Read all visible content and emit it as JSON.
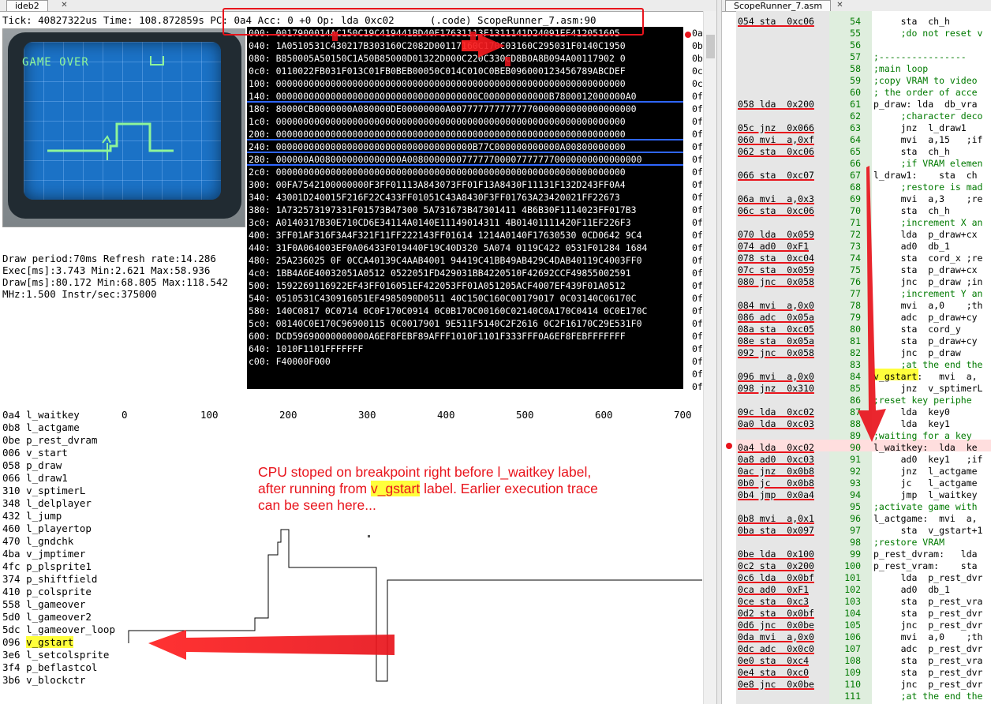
{
  "left_window": {
    "tab_label": "ideb2",
    "close_glyph": "✕",
    "status_line": "Tick: 40827322us Time: 108.872859s PC: 0a4 Acc: 0 +0 Op: lda 0xc02      (.code) ScopeRunner_7.asm:90",
    "scope_photo": {
      "screen_text": "GAME OVER"
    },
    "stats": [
      "Draw period:70ms Refresh rate:14.286",
      "Exec[ms]:3.743 Min:2.621 Max:58.936",
      "Draw[ms]:80.172 Min:68.805 Max:118.542",
      "MHz:1.500 Instr/sec:375000"
    ],
    "memory_rows": [
      "000: 0017900014AC150C19C419441BD40F17631113F1311141D24091EF412051605",
      "040: 1A0510531C430217B303160C2082D00117160C170C03160C295031F0140C1950",
      "080: B850005A50150C1A50B85000D01322D000C220C330CD8B0A8B094A00117902 0",
      "0c0: 0110022FB031F013C01FB0BEB00050C014C010C0BEB096000123456789ABCDEF",
      "100: 0000000000000000000000000000000000000000000000000000000000000000",
      "140: 0000000000000000000000000000000000000C000000000000B7800012000000A0",
      "180: 80000CB0000000A080000DE00000000A0077777777777770000000000000000000",
      "1c0: 0000000000000000000000000000000000000000000000000000000000000000",
      "200: 0000000000000000000000000000000000000000000000000000000000000000",
      "240: 000000000000000000000000000000000000B77C000000000000A00800000000",
      "280: 000000A0080000000000000A0080000000777777000077777770000000000000000",
      "2c0: 0000000000000000000000000000000000000000000000000000000000000000",
      "300: 00FA7542100000000F3FF01113A843073FF01F13A8430F11131F132D243FF0A4",
      "340: 43001D240015F216F22C433FF01051C43A8430F3FF01763A23420021FF22673",
      "380: 1A732573197331F01573B47300 5A731673B47301411 4B6B30F1114023FF017B3",
      "3c0: A0140317B30E710CD6E34114A0140E11149014311 4B01401111420F11EF226F3",
      "400: 3FF01AF316F3A4F321F11FF222143FF01614 1214A0140F17630530 0CD0642 9C4",
      "440: 31F0A064003EF0A06433F019440F19C40D320 5A074 0119C422 0531F01284 1684",
      "480: 25A236025 0F 0CCA40139C4AAB4001 94419C41BB49AB429C4DAB40119C4003FF0",
      "4c0: 1BB4A6E40032051A0512 0522051FD429031BB4220510F42692CCF49855002591",
      "500: 1592269116922EF43FF016051EF422053FF01A051205ACF4007EF439F01A0512",
      "540: 0510531C430916051EF4985090D0511 40C150C160C00179017 0C03140C06170C",
      "580: 140C0817 0C0714 0C0F170C0914 0C0B170C00160C02140C0A170C0414 0C0E170C",
      "5c0: 08140C0E170C96900115 0C0017901 9E511F5140C2F2616 0C2F16170C29E531F0",
      "600: DCD59690000000000A6EF8FEBF89AFFF1010F1101F333FFF0A6EF8FEBFFFFFFF",
      "640: 1010F1101FFFFFFF",
      "c00: F40000F000"
    ],
    "right_column_values": [
      "0a",
      "0b",
      "0b",
      "0c",
      "0c",
      "0f",
      "0f",
      "0f",
      "0f",
      "0f",
      "0f",
      "0f",
      "0f",
      "0f",
      "0f",
      "0f",
      "0f",
      "0f",
      "0f",
      "0f",
      "0f",
      "0f",
      "0f",
      "0f",
      "0f",
      "0f",
      "0f",
      "0f",
      "0f"
    ],
    "trace": {
      "axis_ticks": [
        "0",
        "100",
        "200",
        "300",
        "400",
        "500",
        "600",
        "700"
      ],
      "labels": [
        "0a4 l_waitkey",
        "0b8 l_actgame",
        "0be p_rest_dvram",
        "006 v_start",
        "058 p_draw",
        "066 l_draw1",
        "310 v_sptimerL",
        "348 l_delplayer",
        "432 l_jump",
        "460 l_playertop",
        "470 l_gndchk",
        "4ba v_jmptimer",
        "4fc p_plsprite1",
        "374 p_shiftfield",
        "410 p_colsprite",
        "558 l_gameover",
        "5d0 l_gameover2",
        "5dc l_gameover_loop",
        "096 v_gstart",
        "3e6 l_setcolsprite",
        "3f4 p_beflastcol",
        "3b6 v_blockctr"
      ],
      "highlighted_label_index": 18
    },
    "annotation": {
      "line1": "CPU stoped on breakpoint right before l_waitkey label,",
      "line2_pre": "after running from ",
      "line2_hl": "v_gstart",
      "line2_post": " label. Earlier execution trace",
      "line3": "can be seen here..."
    },
    "accent_red": "#e8141c",
    "highlight_yellow": "#ffff3c"
  },
  "right_window": {
    "tab_label": "ScopeRunner_7.asm",
    "rows": [
      {
        "addr": "054 sta  0xc06",
        "ul": true,
        "n": "54",
        "code": "     sta  ch_h"
      },
      {
        "addr": "",
        "ul": false,
        "n": "55",
        "code": "     ;do not reset v"
      },
      {
        "addr": "",
        "ul": false,
        "n": "56",
        "code": ""
      },
      {
        "addr": "",
        "ul": false,
        "n": "57",
        "code": ";----------------"
      },
      {
        "addr": "",
        "ul": false,
        "n": "58",
        "code": ";main loop"
      },
      {
        "addr": "",
        "ul": false,
        "n": "59",
        "code": ";copy VRAM to video"
      },
      {
        "addr": "",
        "ul": false,
        "n": "60",
        "code": "; the order of acce"
      },
      {
        "addr": "058 lda  0x200",
        "ul": true,
        "n": "61",
        "code": "p_draw: lda  db_vra"
      },
      {
        "addr": "",
        "ul": false,
        "n": "62",
        "code": "     ;character deco"
      },
      {
        "addr": "05c jnz  0x066",
        "ul": true,
        "n": "63",
        "code": "     jnz  l_draw1"
      },
      {
        "addr": "060 mvi  a,0xf",
        "ul": true,
        "n": "64",
        "code": "     mvi  a,15   ;if"
      },
      {
        "addr": "062 sta  0xc06",
        "ul": true,
        "n": "65",
        "code": "     sta  ch_h"
      },
      {
        "addr": "",
        "ul": false,
        "n": "66",
        "code": "     ;if VRAM elemen"
      },
      {
        "addr": "066 sta  0xc07",
        "ul": true,
        "n": "67",
        "code": "l_draw1:    sta  ch"
      },
      {
        "addr": "",
        "ul": false,
        "n": "68",
        "code": "     ;restore is mad"
      },
      {
        "addr": "06a mvi  a,0x3",
        "ul": true,
        "n": "69",
        "code": "     mvi  a,3    ;re"
      },
      {
        "addr": "06c sta  0xc06",
        "ul": true,
        "n": "70",
        "code": "     sta  ch_h"
      },
      {
        "addr": "",
        "ul": false,
        "n": "71",
        "code": "     ;increment X an"
      },
      {
        "addr": "070 lda  0x059",
        "ul": true,
        "n": "72",
        "code": "     lda  p_draw+cx"
      },
      {
        "addr": "074 ad0  0xF1",
        "ul": true,
        "n": "73",
        "code": "     ad0  db_1"
      },
      {
        "addr": "078 sta  0xc04",
        "ul": true,
        "n": "74",
        "code": "     sta  cord_x ;re"
      },
      {
        "addr": "07c sta  0x059",
        "ul": true,
        "n": "75",
        "code": "     sta  p_draw+cx"
      },
      {
        "addr": "080 jnc  0x058",
        "ul": true,
        "n": "76",
        "code": "     jnc  p_draw ;in"
      },
      {
        "addr": "",
        "ul": false,
        "n": "77",
        "code": "     ;increment Y an"
      },
      {
        "addr": "084 mvi  a,0x0",
        "ul": true,
        "n": "78",
        "code": "     mvi  a,0    ;th"
      },
      {
        "addr": "086 adc  0x05a",
        "ul": true,
        "n": "79",
        "code": "     adc  p_draw+cy"
      },
      {
        "addr": "08a sta  0xc05",
        "ul": true,
        "n": "80",
        "code": "     sta  cord_y"
      },
      {
        "addr": "08e sta  0x05a",
        "ul": true,
        "n": "81",
        "code": "     sta  p_draw+cy"
      },
      {
        "addr": "092 jnc  0x058",
        "ul": true,
        "n": "82",
        "code": "     jnc  p_draw"
      },
      {
        "addr": "",
        "ul": false,
        "n": "83",
        "code": "     ;at the end the"
      },
      {
        "addr": "096 mvi  a,0x0",
        "ul": true,
        "n": "84",
        "code": "v_gstart:   mvi  a,"
      },
      {
        "addr": "098 jnz  0x310",
        "ul": true,
        "n": "85",
        "code": "     jnz  v_sptimerL"
      },
      {
        "addr": "",
        "ul": false,
        "n": "86",
        "code": ";reset key periphe"
      },
      {
        "addr": "09c lda  0xc02",
        "ul": true,
        "n": "87",
        "code": "     lda  key0"
      },
      {
        "addr": "0a0 lda  0xc03",
        "ul": true,
        "n": "88",
        "code": "     lda  key1"
      },
      {
        "addr": "",
        "ul": false,
        "n": "89",
        "code": ";waiting for a key"
      },
      {
        "addr": "0a4 lda  0xc02",
        "ul": true,
        "n": "90",
        "code": "l_waitkey:  lda  ke"
      },
      {
        "addr": "0a8 ad0  0xc03",
        "ul": true,
        "n": "91",
        "code": "     ad0  key1   ;if"
      },
      {
        "addr": "0ac jnz  0x0b8",
        "ul": true,
        "n": "92",
        "code": "     jnz  l_actgame"
      },
      {
        "addr": "0b0 jc   0x0b8",
        "ul": true,
        "n": "93",
        "code": "     jc   l_actgame"
      },
      {
        "addr": "0b4 jmp  0x0a4",
        "ul": true,
        "n": "94",
        "code": "     jmp  l_waitkey"
      },
      {
        "addr": "",
        "ul": false,
        "n": "95",
        "code": ";activate game with"
      },
      {
        "addr": "0b8 mvi  a,0x1",
        "ul": true,
        "n": "96",
        "code": "l_actgame:  mvi  a,"
      },
      {
        "addr": "0ba sta  0x097",
        "ul": true,
        "n": "97",
        "code": "     sta  v_gstart+1"
      },
      {
        "addr": "",
        "ul": false,
        "n": "98",
        "code": ";restore VRAM"
      },
      {
        "addr": "0be lda  0x100",
        "ul": true,
        "n": "99",
        "code": "p_rest_dvram:   lda"
      },
      {
        "addr": "0c2 sta  0x200",
        "ul": true,
        "n": "100",
        "code": "p_rest_vram:    sta"
      },
      {
        "addr": "0c6 lda  0x0bf",
        "ul": true,
        "n": "101",
        "code": "     lda  p_rest_dvr"
      },
      {
        "addr": "0ca ad0  0xF1",
        "ul": true,
        "n": "102",
        "code": "     ad0  db_1"
      },
      {
        "addr": "0ce sta  0xc3",
        "ul": true,
        "n": "103",
        "code": "     sta  p_rest_vra"
      },
      {
        "addr": "0d2 sta  0x0bf",
        "ul": true,
        "n": "104",
        "code": "     sta  p_rest_dvr"
      },
      {
        "addr": "0d6 jnc  0x0be",
        "ul": true,
        "n": "105",
        "code": "     jnc  p_rest_dvr"
      },
      {
        "addr": "0da mvi  a,0x0",
        "ul": true,
        "n": "106",
        "code": "     mvi  a,0    ;th"
      },
      {
        "addr": "0dc adc  0x0c0",
        "ul": true,
        "n": "107",
        "code": "     adc  p_rest_dvr"
      },
      {
        "addr": "0e0 sta  0xc4",
        "ul": true,
        "n": "108",
        "code": "     sta  p_rest_vra"
      },
      {
        "addr": "0e4 sta  0xc0",
        "ul": true,
        "n": "109",
        "code": "     sta  p_rest_dvr"
      },
      {
        "addr": "0e8 jnc  0x0be",
        "ul": true,
        "n": "110",
        "code": "     jnc  p_rest_dvr"
      },
      {
        "addr": "",
        "ul": false,
        "n": "111",
        "code": "     ;at the end the"
      }
    ],
    "current_line_number": "90"
  }
}
